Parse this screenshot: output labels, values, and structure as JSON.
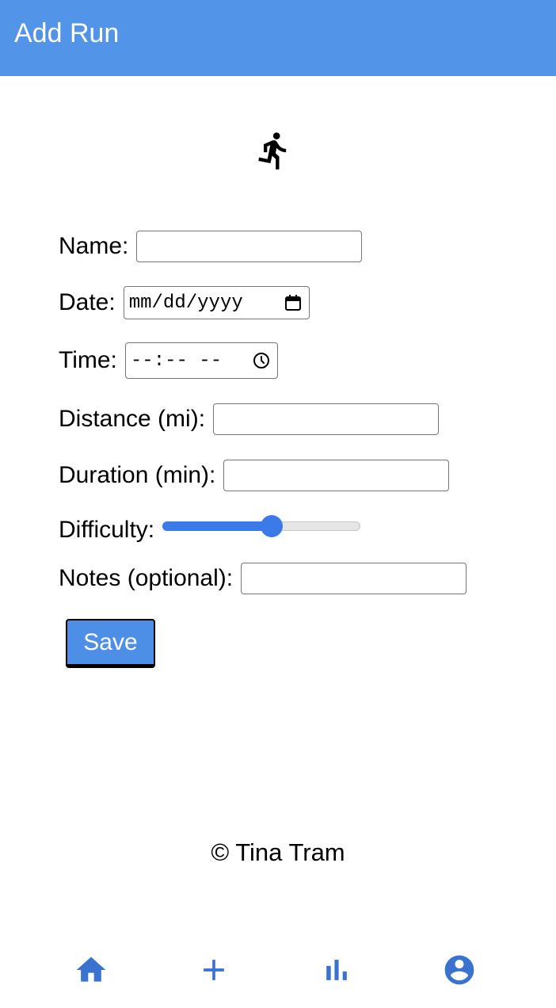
{
  "header": {
    "title": "Add Run"
  },
  "header_icon": "directions-run-icon",
  "form": {
    "name_label": "Name:",
    "name_value": "",
    "date_label": "Date:",
    "date_placeholder": "mm/dd/yyyy",
    "time_label": "Time:",
    "time_placeholder": "--:-- --",
    "distance_label": "Distance (mi):",
    "distance_value": "",
    "duration_label": "Duration (min):",
    "duration_value": "",
    "difficulty_label": "Difficulty:",
    "difficulty_value": 0.55,
    "notes_label": "Notes (optional):",
    "notes_value": "",
    "save_label": "Save"
  },
  "footer": {
    "text": "© Tina Tram"
  },
  "nav": {
    "items": [
      {
        "icon": "home-icon"
      },
      {
        "icon": "add-icon"
      },
      {
        "icon": "bar-chart-icon"
      },
      {
        "icon": "account-circle-icon"
      }
    ]
  },
  "colors": {
    "header_bg": "#5294e8",
    "accent": "#3b7ae8",
    "nav_icon": "#3a72cf"
  }
}
